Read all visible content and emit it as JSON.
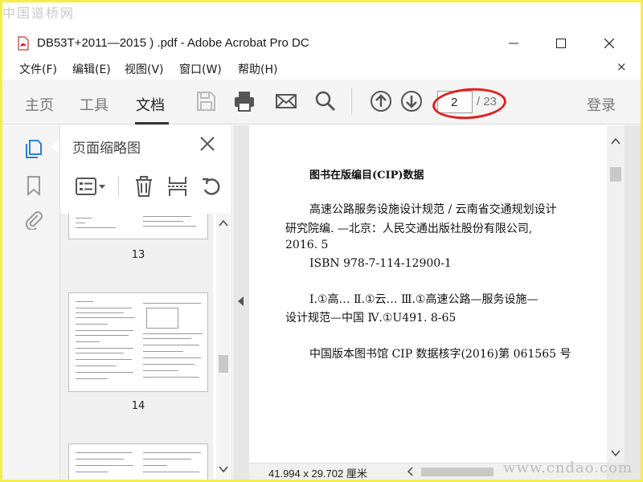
{
  "watermark": {
    "top": "中国道桥网",
    "bottom": "www.cndao.com"
  },
  "window": {
    "title": "DB53T+2011—2015 ) .pdf - Adobe Acrobat Pro DC"
  },
  "menu": {
    "items": [
      "文件(F)",
      "编辑(E)",
      "视图(V)",
      "窗口(W)",
      "帮助(H)"
    ],
    "close": "×"
  },
  "toolbar": {
    "tabs": [
      "主页",
      "工具",
      "文档"
    ],
    "active_tab": "文档",
    "page_current": "2",
    "page_total": "/ 23",
    "login": "登录"
  },
  "thumbnail_panel": {
    "title": "页面缩略图",
    "thumbs": [
      {
        "label": "13"
      },
      {
        "label": "14"
      }
    ]
  },
  "document": {
    "lines": [
      "图书在版编目(CIP)数据",
      "高速公路服务设施设计规范 / 云南省交通规划设计",
      "研究院编. —北京：人民交通出版社股份有限公司,",
      "2016. 5",
      "ISBN  978-7-114-12900-1",
      "Ⅰ.①高…   Ⅱ.①云…   Ⅲ.①高速公路—服务设施—",
      "设计规范—中国   Ⅳ.①U491. 8-65",
      "中国版本图书馆 CIP 数据核字(2016)第 061565 号"
    ],
    "dimensions": "41.994 x 29.702 厘米"
  },
  "colors": {
    "accent_blue": "#2d7fd3",
    "highlight_red": "#e02020",
    "border_yellow": "#f3ef48"
  }
}
